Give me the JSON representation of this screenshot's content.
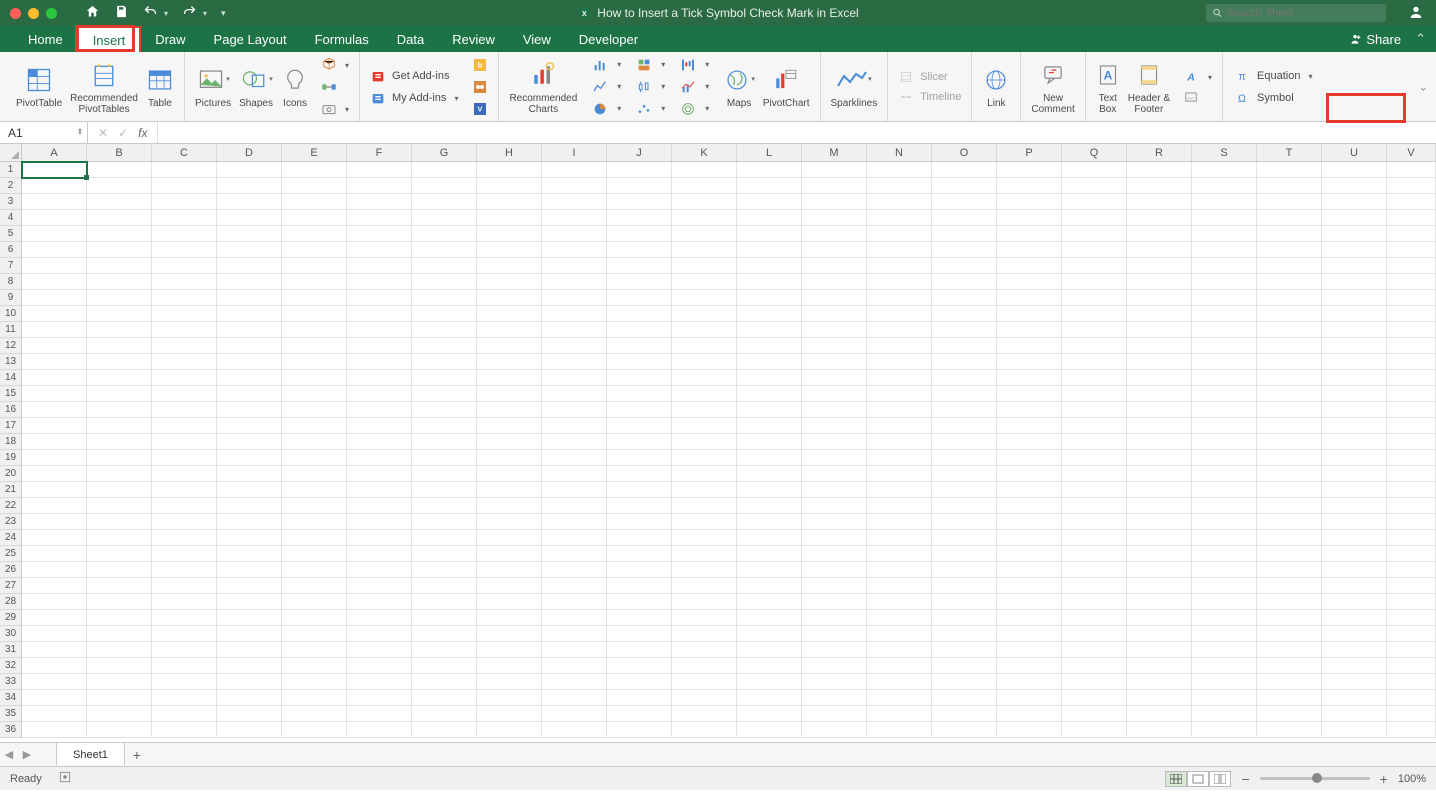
{
  "titlebar": {
    "doc_title": "How to Insert a Tick Symbol Check Mark in Excel",
    "search_placeholder": "Search Sheet"
  },
  "tabs": {
    "home": "Home",
    "insert": "Insert",
    "draw": "Draw",
    "page_layout": "Page Layout",
    "formulas": "Formulas",
    "data": "Data",
    "review": "Review",
    "view": "View",
    "developer": "Developer",
    "share": "Share"
  },
  "ribbon": {
    "pivottable": "PivotTable",
    "rec_pivot": "Recommended\nPivotTables",
    "table": "Table",
    "pictures": "Pictures",
    "shapes": "Shapes",
    "icons": "Icons",
    "get_addins": "Get Add-ins",
    "my_addins": "My Add-ins",
    "rec_charts": "Recommended\nCharts",
    "maps": "Maps",
    "pivotchart": "PivotChart",
    "sparklines": "Sparklines",
    "slicer": "Slicer",
    "timeline": "Timeline",
    "link": "Link",
    "new_comment": "New\nComment",
    "text_box": "Text\nBox",
    "header_footer": "Header &\nFooter",
    "equation": "Equation",
    "symbol": "Symbol"
  },
  "formula_bar": {
    "namebox": "A1",
    "fx": "fx"
  },
  "grid": {
    "columns": [
      "A",
      "B",
      "C",
      "D",
      "E",
      "F",
      "G",
      "H",
      "I",
      "J",
      "K",
      "L",
      "M",
      "N",
      "O",
      "P",
      "Q",
      "R",
      "S",
      "T",
      "U",
      "V"
    ],
    "rows": 36,
    "selected": "A1"
  },
  "sheets": {
    "sheet1": "Sheet1"
  },
  "status": {
    "ready": "Ready",
    "zoom": "100%"
  }
}
